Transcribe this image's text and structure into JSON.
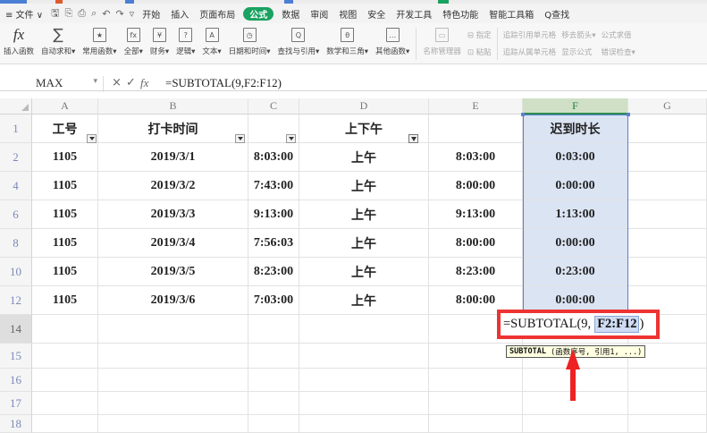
{
  "colors": {
    "accent_green": "#1aa260",
    "highlight_red": "#e33333",
    "selection_blue": "#dbe4f3",
    "row_header_blue": "#7a8ab8"
  },
  "menubar": {
    "items": [
      {
        "label": "≡ 文件 ∨"
      },
      {
        "label": "开始"
      },
      {
        "label": "插入"
      },
      {
        "label": "页面布局"
      },
      {
        "label": "公式",
        "active": true
      },
      {
        "label": "数据"
      },
      {
        "label": "审阅"
      },
      {
        "label": "视图"
      },
      {
        "label": "安全"
      },
      {
        "label": "开发工具"
      },
      {
        "label": "特色功能"
      },
      {
        "label": "智能工具箱"
      },
      {
        "label": "Q查找"
      }
    ]
  },
  "ribbon": {
    "buttons": [
      {
        "icon": "fx",
        "label": "插入函数"
      },
      {
        "icon": "∑",
        "label": "自动求和▾"
      },
      {
        "icon": "★",
        "label": "常用函数▾"
      },
      {
        "icon": "fx",
        "label": "全部▾"
      },
      {
        "icon": "¥",
        "label": "财务▾"
      },
      {
        "icon": "?",
        "label": "逻辑▾"
      },
      {
        "icon": "A",
        "label": "文本▾"
      },
      {
        "icon": "◷",
        "label": "日期和时间▾"
      },
      {
        "icon": "Q",
        "label": "查找与引用▾"
      },
      {
        "icon": "θ",
        "label": "数学和三角▾"
      },
      {
        "icon": "…",
        "label": "其他函数▾"
      }
    ],
    "dim_buttons": [
      {
        "icon": "▭",
        "label": "名称管理器"
      }
    ],
    "dim_small": [
      {
        "top": "⊟ 指定",
        "bottom": "⊡ 粘贴"
      },
      {
        "top": "追踪引用单元格",
        "bottom": "追踪从属单元格"
      },
      {
        "top": "移去箭头▾",
        "bottom": "显示公式"
      },
      {
        "top": "公式求值",
        "bottom": "错误检查▾"
      }
    ]
  },
  "formula_bar": {
    "name_box": "MAX",
    "cancel": "×",
    "confirm": "✓",
    "fx": "fx",
    "formula": "=SUBTOTAL(9,F2:F12)"
  },
  "sheet": {
    "columns": [
      "A",
      "B",
      "C",
      "D",
      "E",
      "F",
      "G"
    ],
    "header_row": {
      "row": "1",
      "cells": [
        "工号",
        "打卡时间",
        "",
        "上下午",
        "",
        "迟到时长",
        ""
      ]
    },
    "rows": [
      {
        "row": "2",
        "cells": [
          "1105",
          "2019/3/1",
          "8:03:00",
          "上午",
          "8:03:00",
          "0:03:00",
          ""
        ]
      },
      {
        "row": "4",
        "cells": [
          "1105",
          "2019/3/2",
          "7:43:00",
          "上午",
          "8:00:00",
          "0:00:00",
          ""
        ]
      },
      {
        "row": "6",
        "cells": [
          "1105",
          "2019/3/3",
          "9:13:00",
          "上午",
          "9:13:00",
          "1:13:00",
          ""
        ]
      },
      {
        "row": "8",
        "cells": [
          "1105",
          "2019/3/4",
          "7:56:03",
          "上午",
          "8:00:00",
          "0:00:00",
          ""
        ]
      },
      {
        "row": "10",
        "cells": [
          "1105",
          "2019/3/5",
          "8:23:00",
          "上午",
          "8:23:00",
          "0:23:00",
          ""
        ]
      },
      {
        "row": "12",
        "cells": [
          "1105",
          "2019/3/6",
          "7:03:00",
          "上午",
          "8:00:00",
          "0:00:00",
          ""
        ]
      }
    ],
    "empty_rows": [
      "14",
      "15",
      "16",
      "17",
      "18"
    ],
    "editing": {
      "prefix": "=SUBTOTAL(9, ",
      "ref": "F2:F12",
      "suffix": " )",
      "tooltip_fn": "SUBTOTAL",
      "tooltip_args": "(函数序号, 引用1, ...)"
    }
  }
}
